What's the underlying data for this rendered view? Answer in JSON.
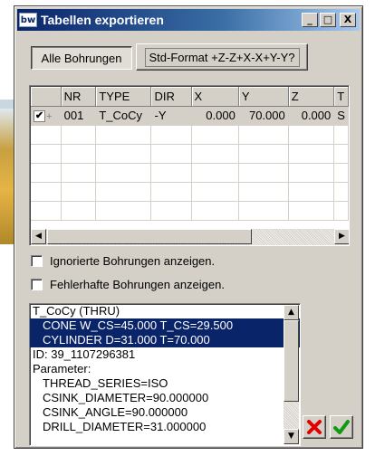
{
  "window": {
    "app_icon_text": "bw",
    "title": "Tabellen exportieren",
    "minimize_label": "_",
    "maximize_label": "□",
    "close_label": "X"
  },
  "tabs": {
    "all_holes": "Alle Bohrungen",
    "std_format": "Std-Format +Z-Z+X-X+Y-Y?"
  },
  "grid": {
    "columns": [
      "",
      "NR",
      "TYPE",
      "DIR",
      "X",
      "Y",
      "Z",
      "T"
    ],
    "rows": [
      {
        "checked": true,
        "nr": "001",
        "type": "T_CoCy",
        "dir": "-Y",
        "x": "0.000",
        "y": "70.000",
        "z": "0.000",
        "t": "S"
      }
    ]
  },
  "options": {
    "show_ignored": "Ignorierte Bohrungen anzeigen.",
    "show_faulty": "Fehlerhafte Bohrungen anzeigen."
  },
  "info": {
    "lines": [
      {
        "text": "T_CoCy (THRU)",
        "indent": false,
        "highlight": false
      },
      {
        "text": "CONE  W_CS=45.000 T_CS=29.500",
        "indent": true,
        "highlight": true
      },
      {
        "text": "CYLINDER  D=31.000 T=70.000",
        "indent": true,
        "highlight": true
      },
      {
        "text": "ID: 39_1107296381",
        "indent": false,
        "highlight": false
      },
      {
        "text": "Parameter:",
        "indent": false,
        "highlight": false
      },
      {
        "text": "THREAD_SERIES=ISO",
        "indent": true,
        "highlight": false
      },
      {
        "text": "CSINK_DIAMETER=90.000000",
        "indent": true,
        "highlight": false
      },
      {
        "text": "CSINK_ANGLE=90.000000",
        "indent": true,
        "highlight": false
      },
      {
        "text": "DRILL_DIAMETER=31.000000",
        "indent": true,
        "highlight": false
      }
    ]
  },
  "icons": {
    "cancel": "red-x-icon",
    "ok": "green-check-icon"
  },
  "colors": {
    "titlebar": "#0a246a",
    "selection": "#0a246a",
    "cancel": "#e00000",
    "ok": "#109a10"
  }
}
